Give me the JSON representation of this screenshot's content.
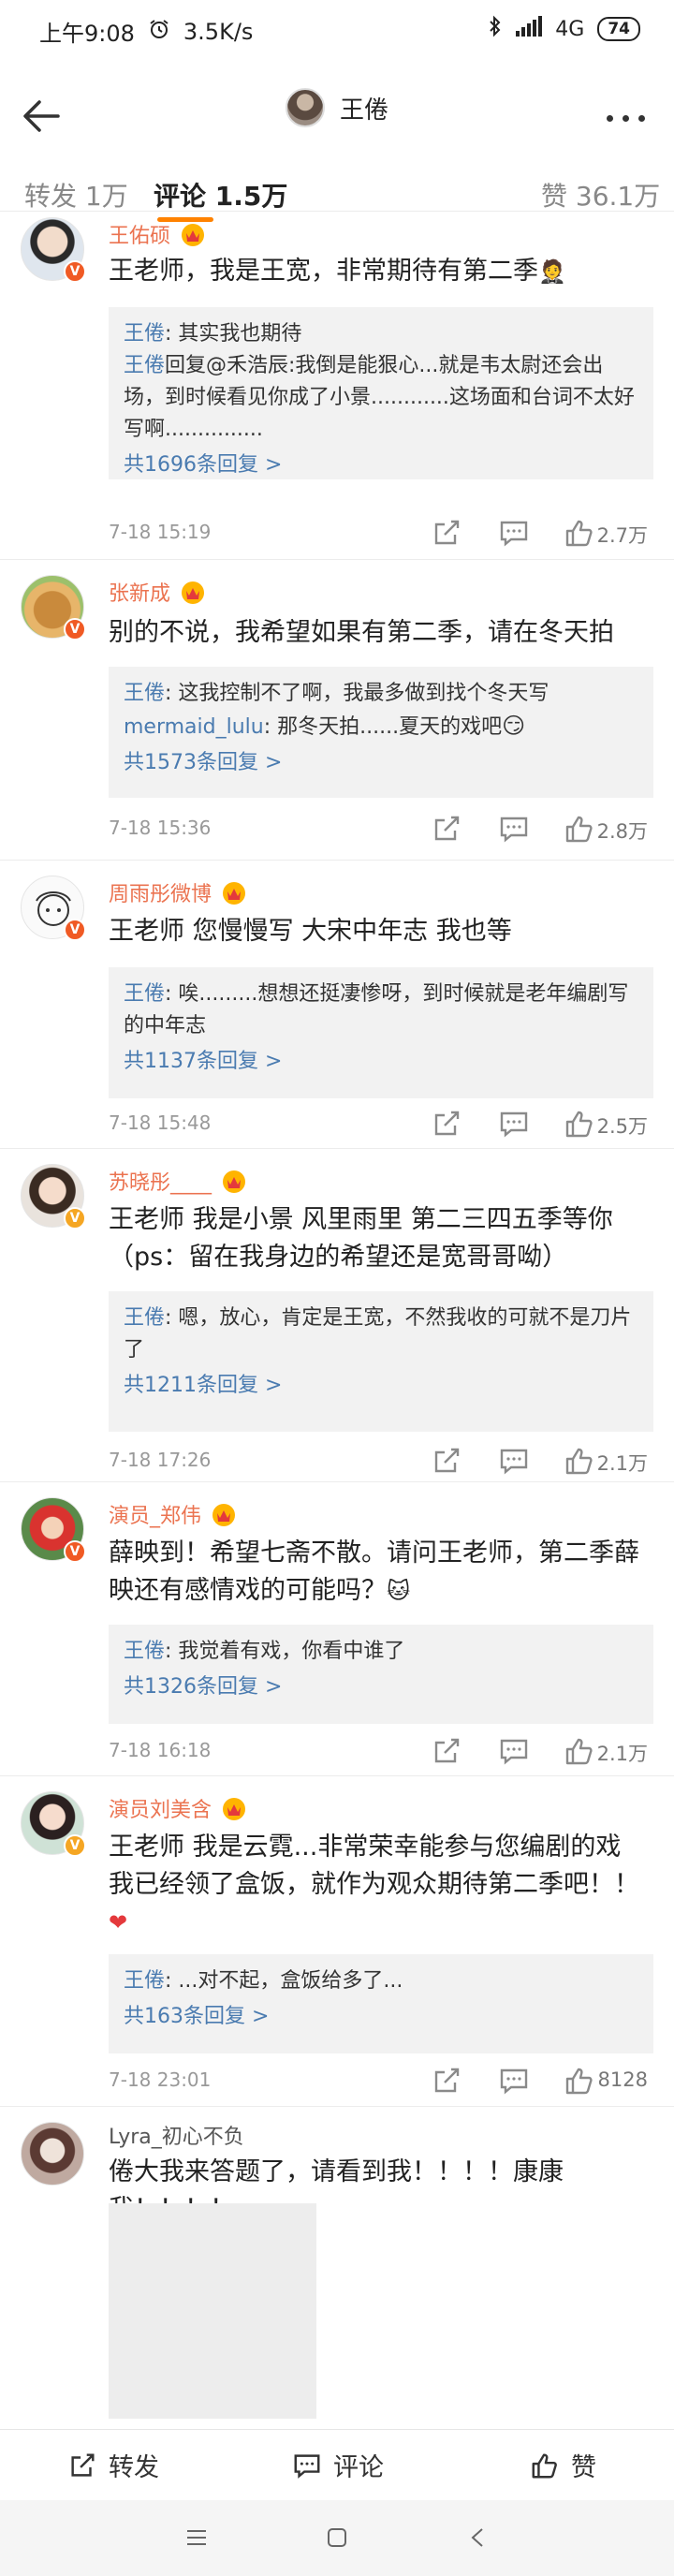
{
  "status_bar": {
    "time": "上午9:08",
    "net_speed": "3.5K/s",
    "network": "4G",
    "battery": "74"
  },
  "header": {
    "title": "王倦"
  },
  "tabs": {
    "repost": "转发 1万",
    "comments": "评论 1.5万",
    "likes": "赞 36.1万"
  },
  "comments": [
    {
      "name": "王佑硕",
      "text": "王老师，我是王宽，非常期待有第二季",
      "replies": [
        {
          "name": "王倦",
          "text": ": 其实我也期待"
        },
        {
          "name": "王倦",
          "text": "回复@禾浩辰:我倒是能狠心...就是韦太尉还会出场，到时候看见你成了小景............这场面和台词不太好写啊..............."
        }
      ],
      "more": "共1696条回复 >",
      "time": "7-18 15:19",
      "likes": "2.7万"
    },
    {
      "name": "张新成",
      "text": "别的不说，我希望如果有第二季，请在冬天拍",
      "replies": [
        {
          "name": "王倦",
          "text": ": 这我控制不了啊，我最多做到找个冬天写"
        },
        {
          "name": "mermaid_lulu",
          "text": ": 那冬天拍......夏天的戏吧"
        }
      ],
      "more": "共1573条回复 >",
      "time": "7-18 15:36",
      "likes": "2.8万"
    },
    {
      "name": "周雨彤微博",
      "text": "王老师 您慢慢写 大宋中年志 我也等",
      "replies": [
        {
          "name": "王倦",
          "text": ": 唉.........想想还挺凄惨呀，到时候就是老年编剧写的中年志"
        }
      ],
      "more": "共1137条回复 >",
      "time": "7-18 15:48",
      "likes": "2.5万"
    },
    {
      "name": "苏晓彤____",
      "text": "王老师 我是小景 风里雨里 第二三四五季等你（ps：留在我身边的希望还是宽哥哥呦）",
      "replies": [
        {
          "name": "王倦",
          "text": ": 嗯，放心，肯定是王宽，不然我收的可就不是刀片了"
        }
      ],
      "more": "共1211条回复 >",
      "time": "7-18 17:26",
      "likes": "2.1万"
    },
    {
      "name": "演员_郑伟",
      "text": "薛映到！希望七斋不散。请问王老师，第二季薛映还有感情戏的可能吗？",
      "replies": [
        {
          "name": "王倦",
          "text": ": 我觉着有戏，你看中谁了"
        }
      ],
      "more": "共1326条回复 >",
      "time": "7-18 16:18",
      "likes": "2.1万"
    },
    {
      "name": "演员刘美含",
      "text": "王老师 我是云霓...非常荣幸能参与您编剧的戏 我已经领了盒饭，就作为观众期待第二季吧！！",
      "replies": [
        {
          "name": "王倦",
          "text": ": ...对不起，盒饭给多了..."
        }
      ],
      "more": "共163条回复 >",
      "time": "7-18 23:01",
      "likes": "8128"
    },
    {
      "name": "Lyra_初心不负",
      "text": "倦大我来答题了，请看到我！！！！康康我！！！！"
    }
  ],
  "bottom_bar": {
    "repost": "转发",
    "comment": "评论",
    "like": "赞"
  },
  "colors": {
    "accent": "#ff8200",
    "name": "#eb7350",
    "link": "#4a7bb0"
  }
}
